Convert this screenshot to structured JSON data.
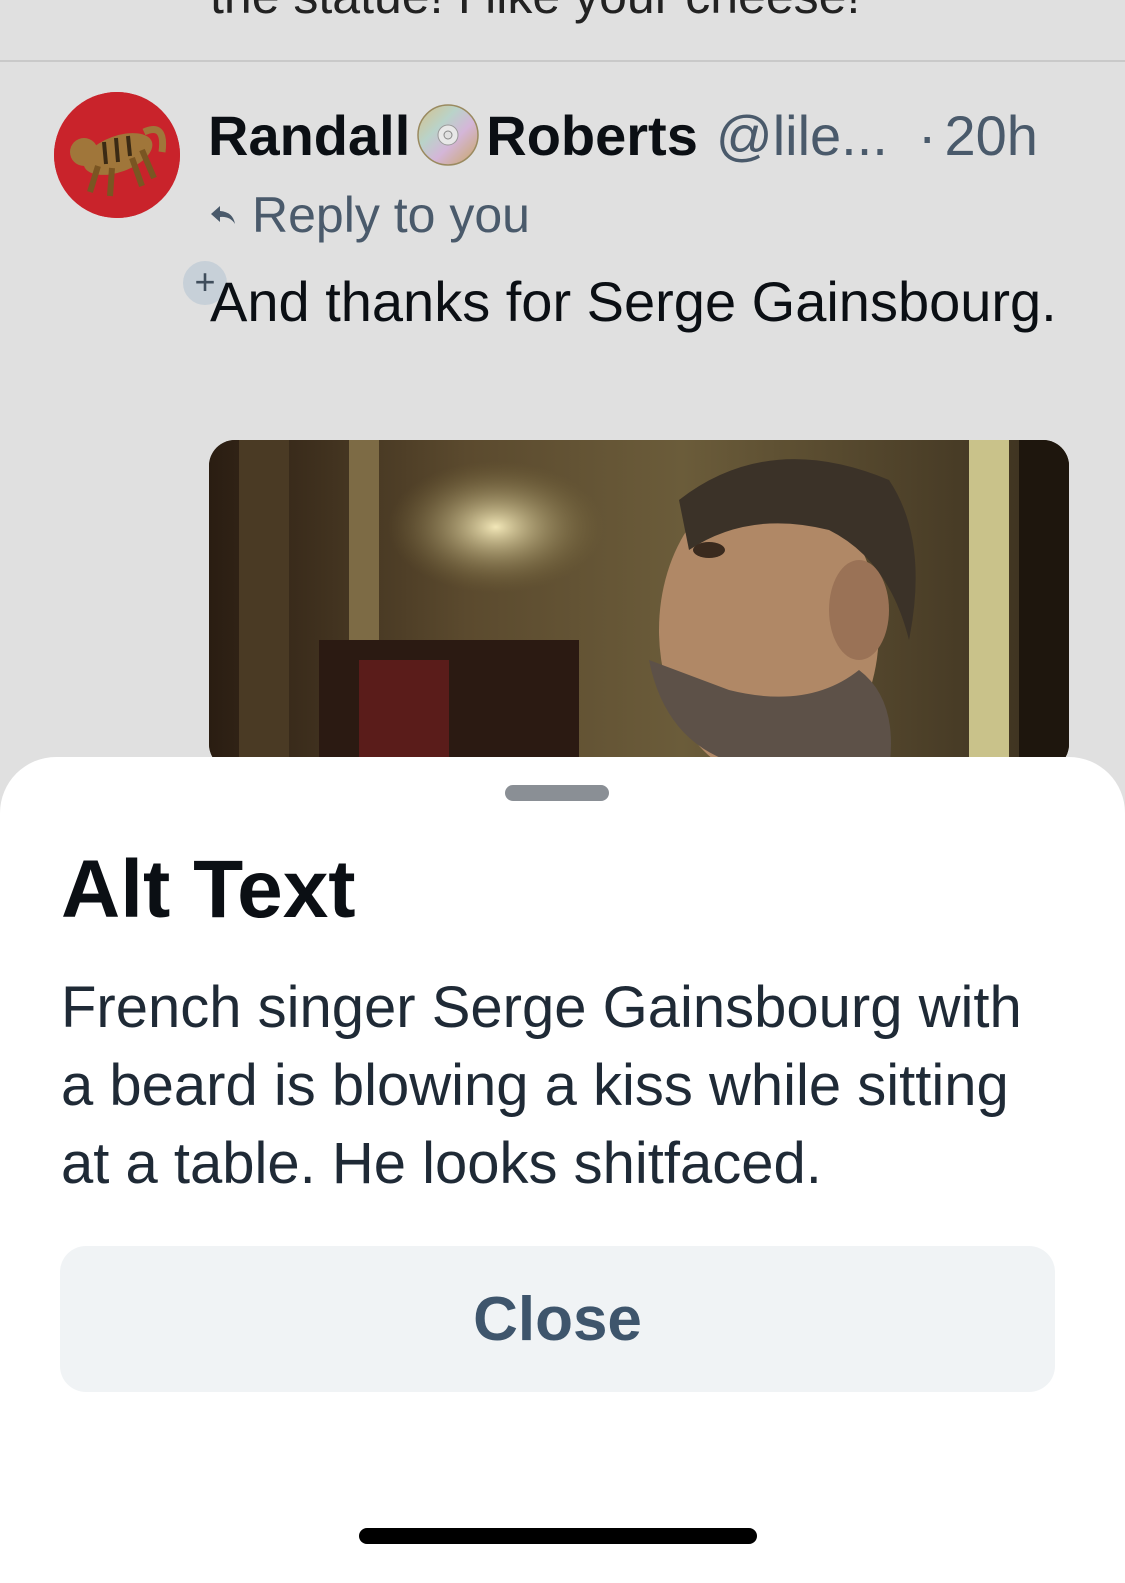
{
  "feed": {
    "prev_post_snippet": "the statue! I like your cheese!"
  },
  "post": {
    "avatar_icon": "tabby-cat-avatar-icon",
    "follow_badge": "+",
    "display_name_first": "Randall",
    "display_name_emoji": "cd-disc-icon",
    "display_name_last": "Roberts",
    "handle": "@lile...",
    "separator": "·",
    "timestamp": "20h",
    "reply_label": "Reply to you",
    "text": "And thanks for Serge Gainsbourg."
  },
  "alt_text_sheet": {
    "title": "Alt Text",
    "description": "French singer Serge Gainsbourg with a beard is blowing a kiss while sitting at a table. He looks shitfaced.",
    "close_label": "Close"
  },
  "colors": {
    "feed_background": "#e0e0e0",
    "sheet_background": "#ffffff",
    "close_button_bg": "#f0f3f5",
    "close_button_text": "#3e556c",
    "muted_text": "#4a5a6b",
    "avatar_red": "#c9232b"
  }
}
